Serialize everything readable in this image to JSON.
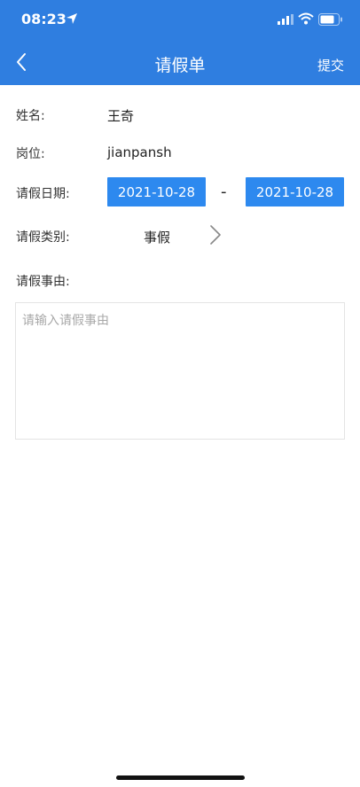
{
  "status_bar": {
    "time": "08:23"
  },
  "nav": {
    "title": "请假单",
    "submit_label": "提交"
  },
  "form": {
    "name_label": "姓名:",
    "name_value": "王奇",
    "position_label": "岗位:",
    "position_value": "jianpansh",
    "date_label": "请假日期:",
    "start_date": "2021-10-28",
    "date_separator": "-",
    "end_date": "2021-10-28",
    "type_label": "请假类别:",
    "type_value": "事假",
    "reason_label": "请假事由:",
    "reason_value": "",
    "reason_placeholder": "请输入请假事由"
  },
  "colors": {
    "header_blue": "#2f7ee0",
    "button_blue": "#2d89ef"
  }
}
